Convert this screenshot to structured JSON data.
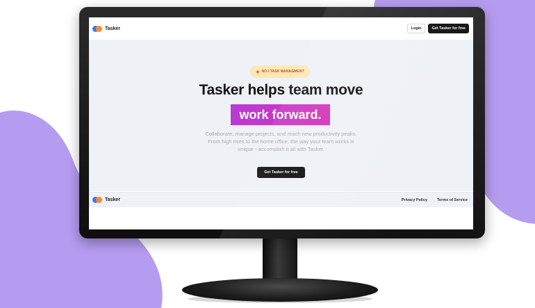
{
  "site": {
    "brand": "Tasker",
    "nav": {
      "login": "Login",
      "cta": "Get Tasker for free"
    },
    "hero": {
      "badge": "NO I TASK MANAGMENT",
      "headline": "Tasker helps team move",
      "highlight": "work forward.",
      "description_lines": [
        "Collaborate, manage projects, and reach new productivity peaks.",
        "From high rises to the home office, the way your team works is",
        "unique - accomplish it all with Tasker."
      ],
      "cta": "Get Tasker for free"
    },
    "footer": {
      "brand": "Tasker",
      "links": [
        "Privacy Policy",
        "Terms of Service"
      ]
    }
  },
  "colors": {
    "blob": "#b69cf0",
    "hero_bg": "#eef1f6",
    "highlight_from": "#b83bd3",
    "highlight_to": "#d636b8",
    "badge_bg": "#fde7b6",
    "badge_text": "#b3561a",
    "button_dark": "#111111"
  },
  "icons": {
    "logo": "tasker-logo-icon",
    "badge": "badge-award-icon"
  }
}
